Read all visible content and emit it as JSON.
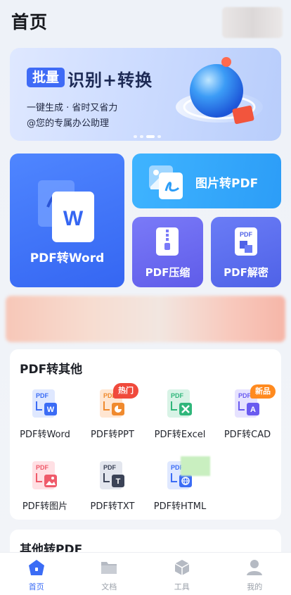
{
  "header": {
    "title": "首页"
  },
  "banner": {
    "tag": "批量",
    "title": "识别+转换",
    "line1": "一键生成 · 省时又省力",
    "line2": "@您的专属办公助理",
    "slides": 4,
    "active_slide": 2
  },
  "tiles": {
    "word": "PDF转Word",
    "image": "图片转PDF",
    "compress": "PDF压缩",
    "decrypt": "PDF解密"
  },
  "section_pdf_to_other": {
    "title": "PDF转其他",
    "items": [
      {
        "label": "PDF转Word",
        "icon": "pdf-to-word-icon",
        "accent": "#3b6cf5"
      },
      {
        "label": "PDF转PPT",
        "icon": "pdf-to-ppt-icon",
        "accent": "#f08a2e",
        "badge": "热门"
      },
      {
        "label": "PDF转Excel",
        "icon": "pdf-to-excel-icon",
        "accent": "#2fb67a"
      },
      {
        "label": "PDF转CAD",
        "icon": "pdf-to-cad-icon",
        "accent": "#6a5bf0",
        "badge": "新品"
      },
      {
        "label": "PDF转图片",
        "icon": "pdf-to-image-icon",
        "accent": "#ef5a6a"
      },
      {
        "label": "PDF转TXT",
        "icon": "pdf-to-txt-icon",
        "accent": "#3b4357"
      },
      {
        "label": "PDF转HTML",
        "icon": "pdf-to-html-icon",
        "accent": "#3b6cf5"
      }
    ]
  },
  "section_other_to_pdf": {
    "title": "其他转PDF"
  },
  "tabbar": {
    "items": [
      {
        "label": "首页",
        "icon": "home-icon",
        "active": true
      },
      {
        "label": "文档",
        "icon": "folder-icon",
        "active": false
      },
      {
        "label": "工具",
        "icon": "toolbox-icon",
        "active": false
      },
      {
        "label": "我的",
        "icon": "user-icon",
        "active": false
      }
    ]
  },
  "colors": {
    "primary": "#3b6cf5",
    "hot_badge": "#f04a3c",
    "new_badge": "#ff8a1f",
    "tab_inactive": "#9aa0a9"
  }
}
